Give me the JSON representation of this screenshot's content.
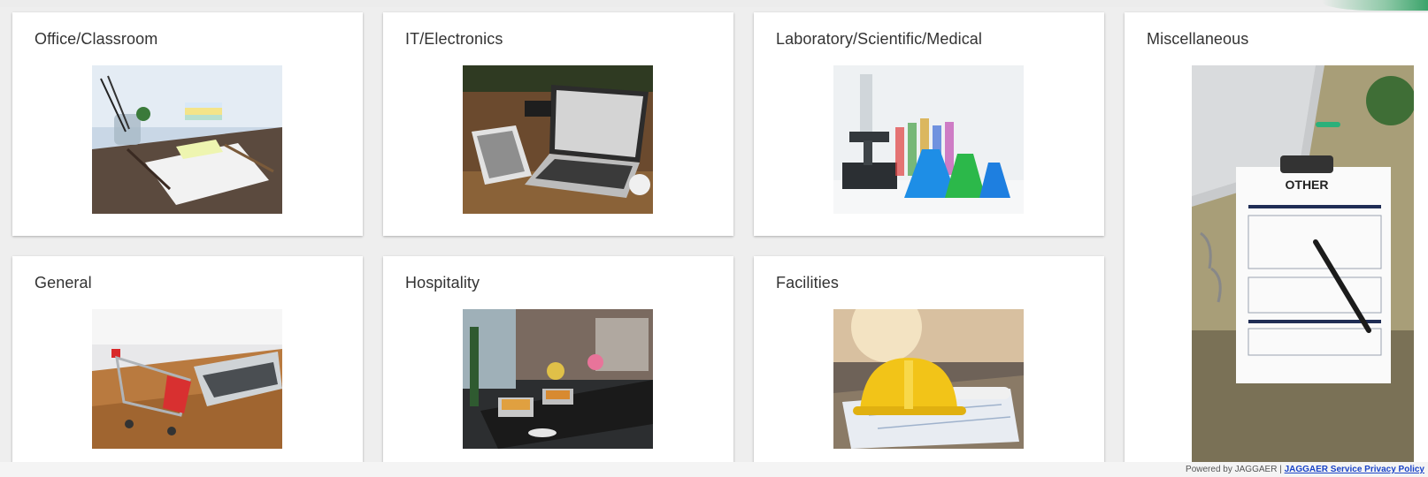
{
  "categories": [
    {
      "title": "Office/Classroom",
      "image_icon": "office-desk-photo"
    },
    {
      "title": "IT/Electronics",
      "image_icon": "laptop-tablet-photo"
    },
    {
      "title": "Laboratory/Scientific/Medical",
      "image_icon": "microscope-flasks-photo"
    },
    {
      "title": "Miscellaneous",
      "image_icon": "clipboard-other-photo",
      "image_text": "OTHER"
    },
    {
      "title": "General",
      "image_icon": "shopping-cart-laptop-photo"
    },
    {
      "title": "Hospitality",
      "image_icon": "buffet-table-photo"
    },
    {
      "title": "Facilities",
      "image_icon": "hard-hat-blueprints-photo"
    }
  ],
  "footer": {
    "powered_by": "Powered by JAGGAER |",
    "link_text": "JAGGAER Service Privacy Policy"
  },
  "colors": {
    "background": "#eeeeee",
    "card": "#ffffff",
    "title_text": "#333333",
    "link": "#1a44c8",
    "corner_accent": "#3aa36a"
  }
}
